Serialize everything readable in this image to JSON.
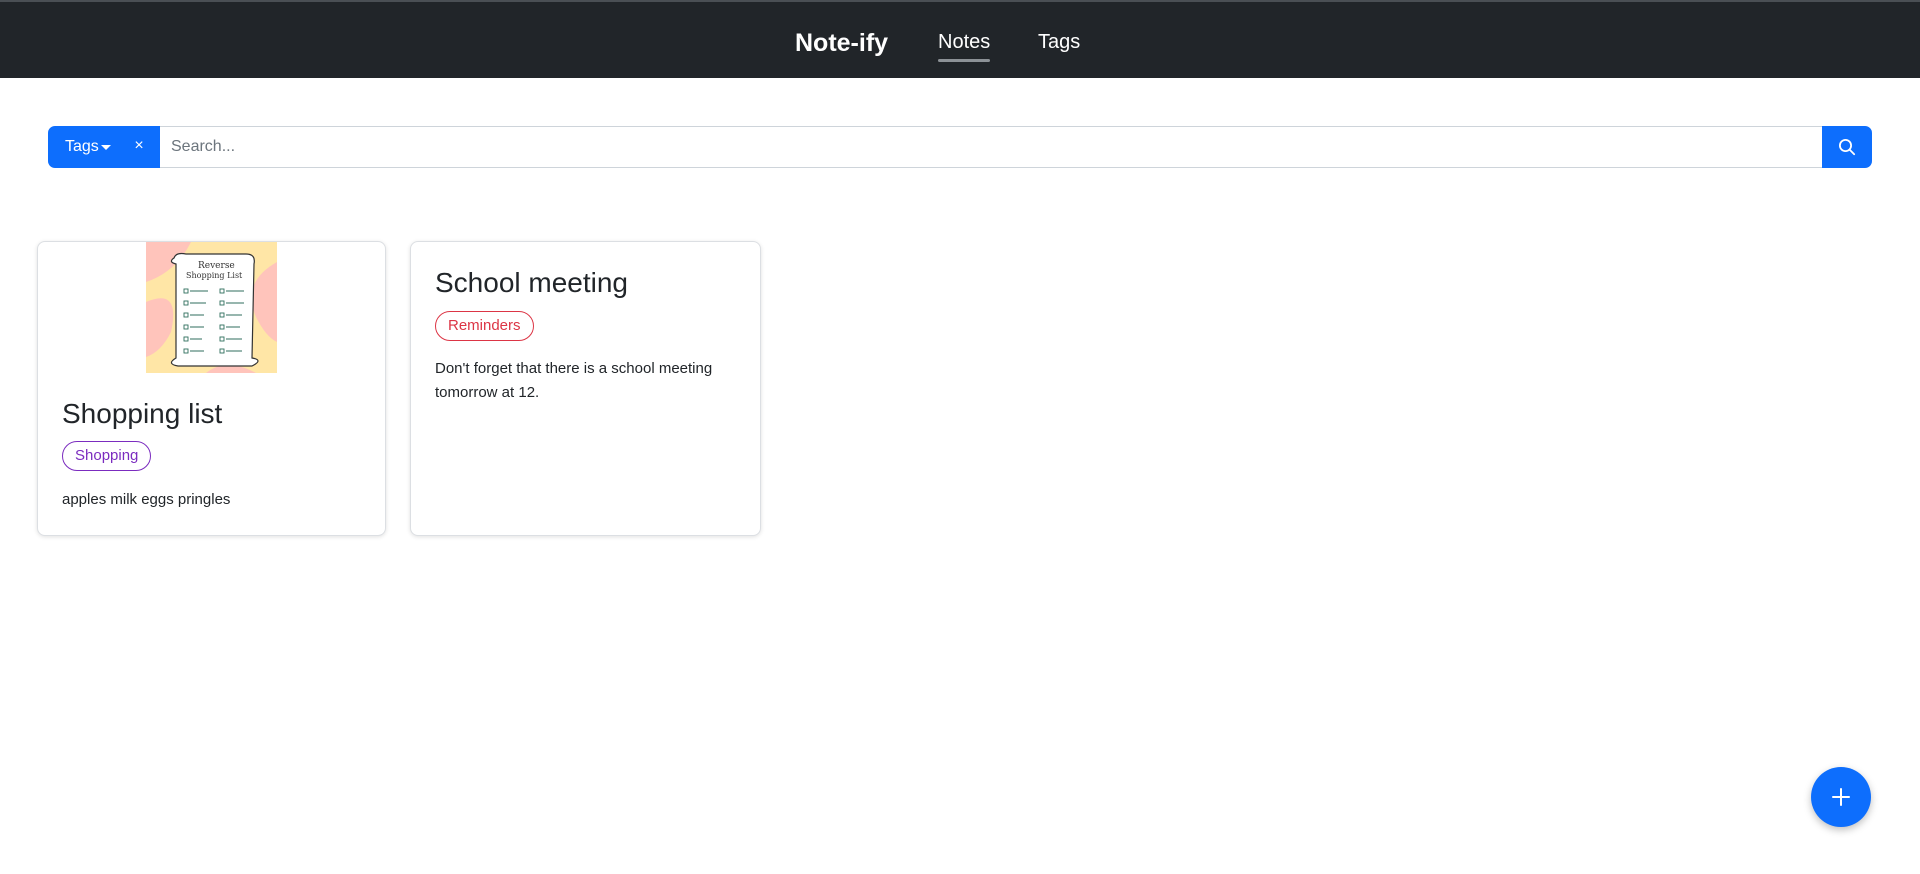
{
  "navbar": {
    "brand": "Note-ify",
    "links": [
      {
        "label": "Notes",
        "active": true
      },
      {
        "label": "Tags",
        "active": false
      }
    ]
  },
  "search": {
    "tags_button_label": "Tags",
    "clear_label": "×",
    "placeholder": "Search...",
    "value": "",
    "search_icon": "search-icon"
  },
  "notes": [
    {
      "title": "Shopping list",
      "tag": {
        "label": "Shopping",
        "color": "#7b2cbf"
      },
      "body": "apples milk eggs pringles",
      "image": "shopping-list-drawing"
    },
    {
      "title": "School meeting",
      "tag": {
        "label": "Reminders",
        "color": "#dc3545"
      },
      "body": "Don't forget that there is a school meeting tomorrow at 12."
    }
  ],
  "fab": {
    "icon": "plus-icon"
  },
  "colors": {
    "primary": "#0d6efd",
    "navbar": "#212529"
  }
}
